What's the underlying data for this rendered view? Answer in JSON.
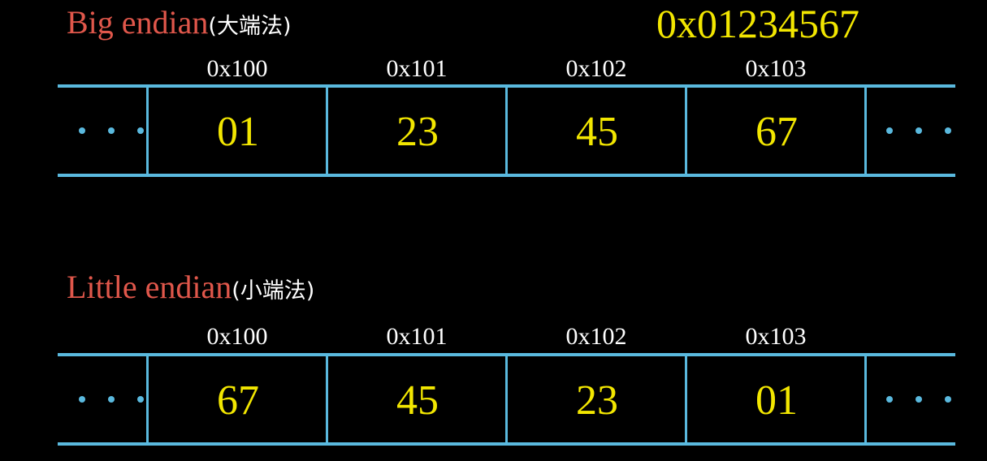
{
  "value_label": "0x01234567",
  "big_endian": {
    "title": "Big endian",
    "title_zh": "(大端法)",
    "addresses": [
      "0x100",
      "0x101",
      "0x102",
      "0x103"
    ],
    "bytes": [
      "01",
      "23",
      "45",
      "67"
    ]
  },
  "little_endian": {
    "title": "Little endian",
    "title_zh": "(小端法)",
    "addresses": [
      "0x100",
      "0x101",
      "0x102",
      "0x103"
    ],
    "bytes": [
      "67",
      "45",
      "23",
      "01"
    ]
  },
  "colors": {
    "title": "#e0574b",
    "value": "#f2e600",
    "memory_line": "#5ab9de",
    "address": "#ffffff"
  }
}
